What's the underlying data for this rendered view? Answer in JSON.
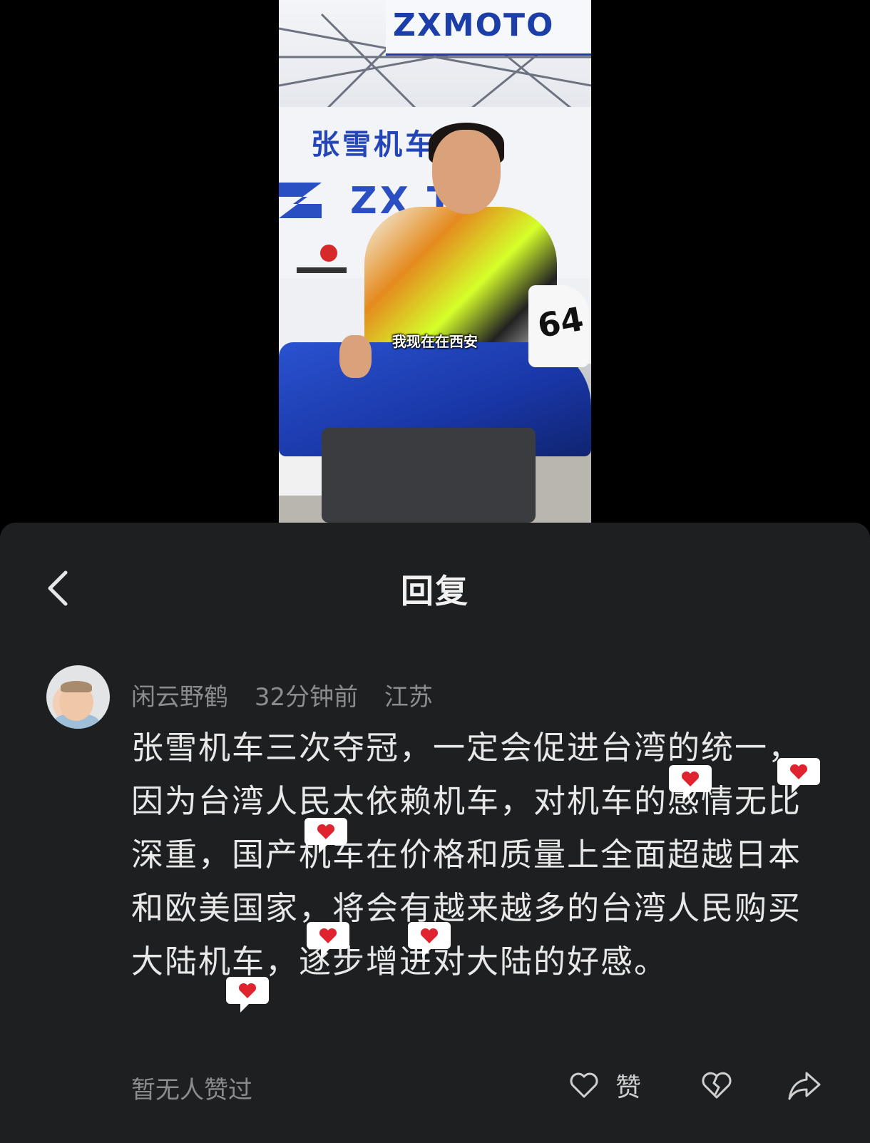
{
  "video": {
    "caption": "我现在在西安",
    "banner_brand": "ZXMOTO",
    "backdrop_title": "张雪机车 队",
    "backdrop_brand": "ZX  TO",
    "bike_number": "64"
  },
  "reply_panel": {
    "title": "回复",
    "comment": {
      "username": "闲云野鹤",
      "time": "32分钟前",
      "location": "江苏",
      "text": "张雪机车三次夺冠，一定会促进台湾的统一，因为台湾人民太依赖机车，对机车的感情无比深重，国产机车在价格和质量上全面超越日本和欧美国家，将会有越来越多的台湾人民购买大陆机车，逐步增进对大陆的好感。",
      "likes_status": "暂无人赞过",
      "like_label": "赞",
      "decoration_icon": "heart-speech-bubble-icon",
      "heart_color": "#e0242f"
    }
  }
}
